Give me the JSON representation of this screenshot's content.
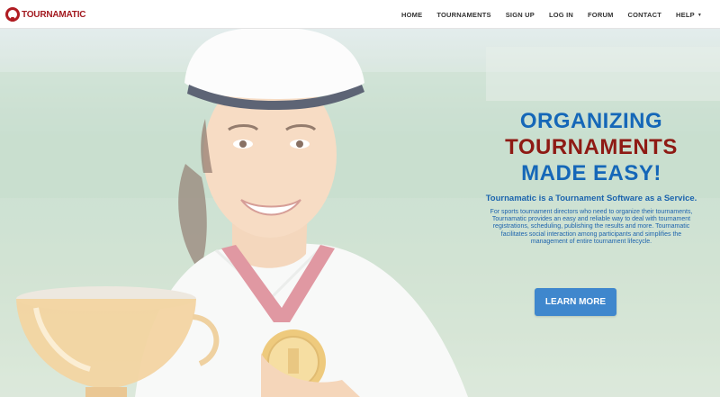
{
  "brand": {
    "name": "TOURNAMATIC",
    "logo_icon": "tournamatic-logo-icon",
    "color": "#a31a20"
  },
  "nav": {
    "items": [
      {
        "label": "HOME"
      },
      {
        "label": "TOURNAMENTS"
      },
      {
        "label": "SIGN UP"
      },
      {
        "label": "LOG IN"
      },
      {
        "label": "FORUM"
      },
      {
        "label": "CONTACT"
      },
      {
        "label": "HELP",
        "has_dropdown": true
      }
    ]
  },
  "hero": {
    "headline": [
      "ORGANIZING",
      "TOURNAMENTS",
      "MADE EASY!"
    ],
    "subtitle": "Tournamatic is a Tournament Software as a Service.",
    "description": "For sports tournament directors who need to organize their tournaments, Tournamatic provides an easy and reliable way to deal with tournament registrations, scheduling, publishing the results and more. Tournamatic facilitates social interaction among participants and simplifies the management of entire tournament lifecycle.",
    "cta_label": "LEARN MORE",
    "colors": {
      "blue": "#1567b8",
      "red": "#8e1a14",
      "button": "#3f87cd"
    }
  }
}
